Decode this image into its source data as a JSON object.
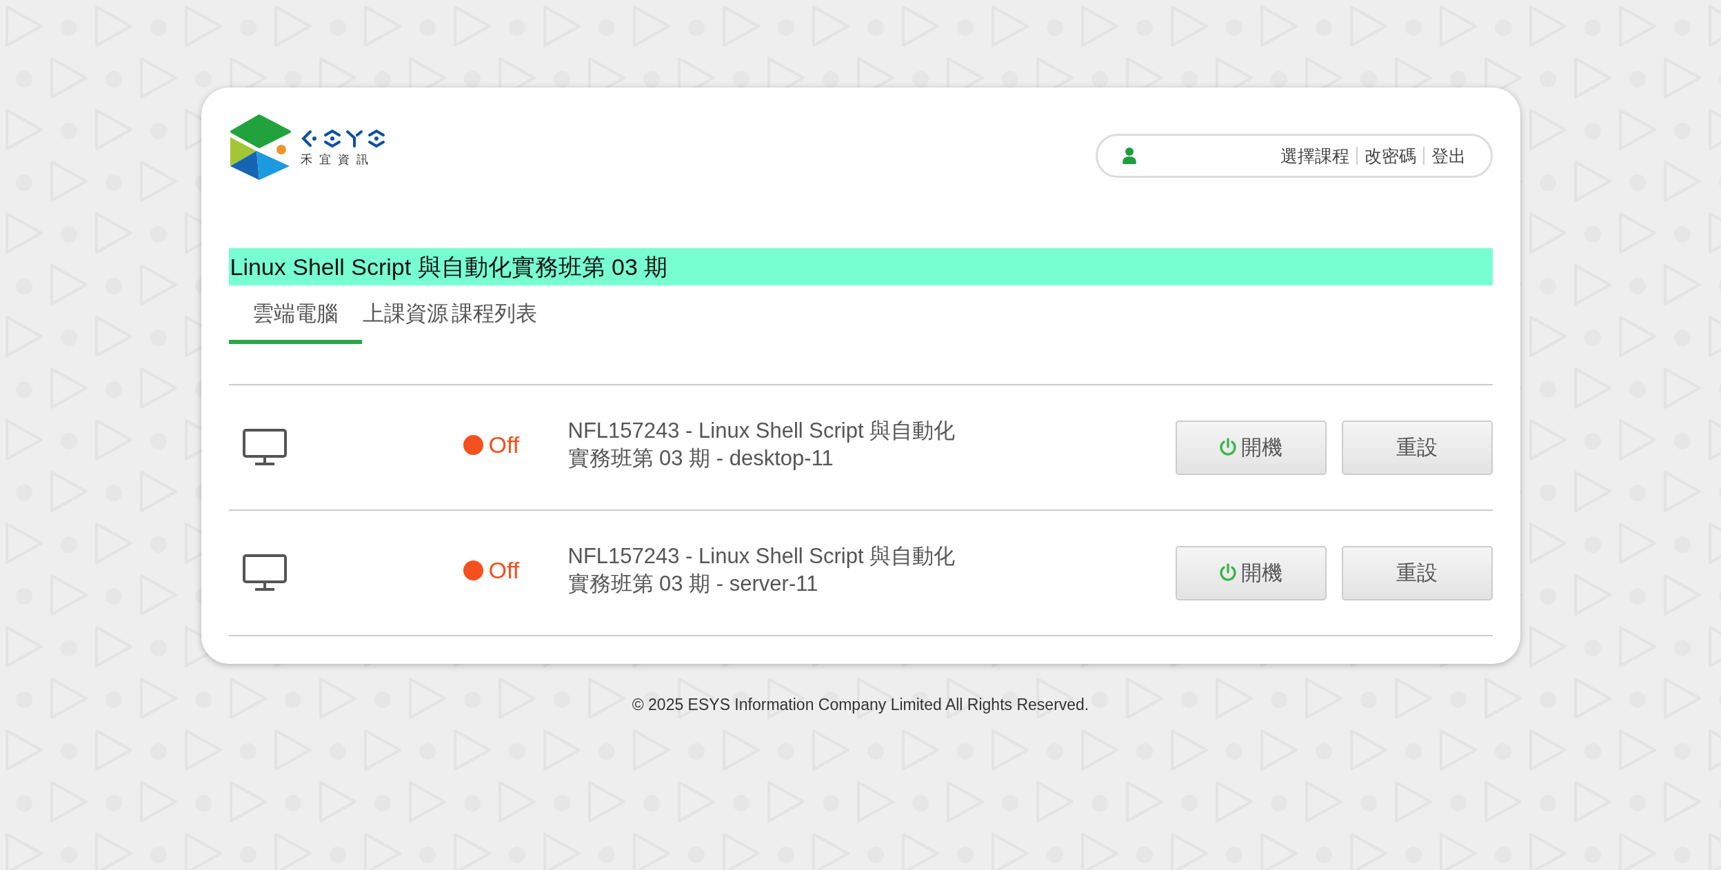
{
  "logo": {
    "text": "禾宜資訊"
  },
  "user_menu": {
    "links": [
      "選擇課程",
      "改密碼",
      "登出"
    ]
  },
  "course_title": "Linux Shell Script 與自動化實務班第 03 期",
  "tabs": [
    {
      "label": "雲端電腦",
      "selected": true
    },
    {
      "label": "上課資源",
      "selected": false
    },
    {
      "label": "課程列表",
      "selected": false
    }
  ],
  "machines": [
    {
      "status": "Off",
      "on": false,
      "name": "NFL157243 - Linux Shell Script 與自動化實務班第 03 期 - desktop-11",
      "buttons": [
        "開機",
        "重設"
      ]
    },
    {
      "status": "Off",
      "on": false,
      "name": "NFL157243 - Linux Shell Script 與自動化實務班第 03 期 - server-11",
      "buttons": [
        "開機",
        "重設"
      ]
    }
  ],
  "footer": "© 2025 ESYS Information Company Limited All Rights Reserved."
}
